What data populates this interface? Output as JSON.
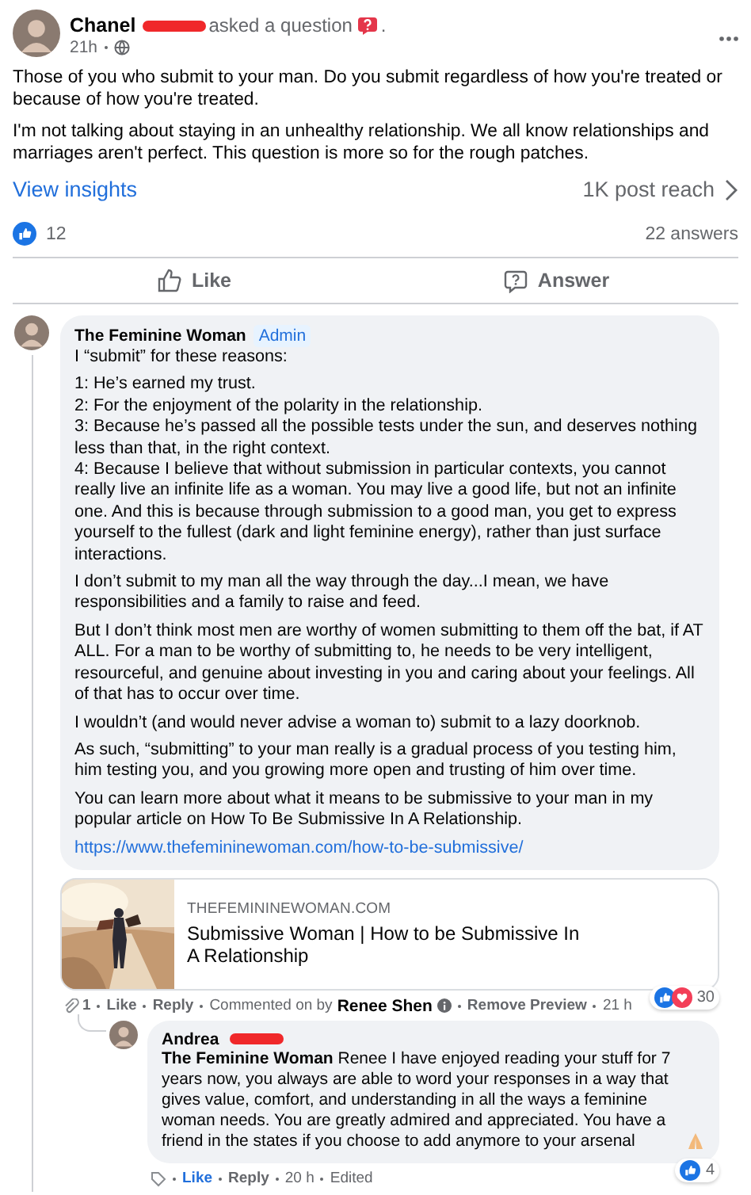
{
  "post": {
    "author": "Chanel",
    "action": "asked a question",
    "action_end": ".",
    "time": "21h",
    "paragraphs": [
      "Those of you who submit to your man. Do you submit regardless of how you're treated or because of how you're treated.",
      "I'm not talking about staying in an unhealthy relationship. We all know relationships and marriages aren't perfect. This question is more so for the rough patches."
    ],
    "insights_link": "View insights",
    "reach": "1K post reach",
    "reaction_count": "12",
    "answers": "22 answers",
    "actions": [
      {
        "kind": "like",
        "label": "Like"
      },
      {
        "kind": "answer",
        "label": "Answer"
      }
    ]
  },
  "comment": {
    "author": "The Feminine Woman",
    "badge": "Admin",
    "intro": "I “submit” for these reasons:",
    "list": [
      "1: He’s earned my trust.",
      "2: For the enjoyment of the polarity in the relationship.",
      "3: Because he’s passed all the possible tests under the sun, and deserves nothing less than that, in the right context.",
      "4: Because I believe that without submission in particular contexts, you cannot really live an infinite life as a woman. You may live a good life, but not an infinite one. And this is because through submission to a good man, you get to express yourself to the fullest (dark and light feminine energy), rather than just surface interactions."
    ],
    "paragraphs": [
      "I don’t submit to my man all the way through the day...I mean, we have responsibilities and a family to raise and feed.",
      "But I don’t think most men are worthy of women submitting to them off the bat, if AT ALL. For a man to be worthy of submitting to, he needs to be very intelligent, resourceful, and genuine about investing in you and caring about your feelings. All of that has to occur over time.",
      "I wouldn’t (and would never advise a woman to) submit to a lazy doorknob.",
      "As such, “submitting” to your man really is a gradual process of you testing him, him testing you, and you growing more open and trusting of him over time.",
      "You can learn more about what it means to be submissive to your man in my popular article on How To Be Submissive In A Relationship."
    ],
    "link": "https://www.thefemininewoman.com/how-to-be-submissive/",
    "preview": {
      "kind": "picture",
      "domain": "THEFEMININEWOMAN.COM",
      "title": "Submissive Woman | How to be Submissive In A Relationship"
    },
    "meta": {
      "attachments": "1",
      "like": "Like",
      "reply": "Reply",
      "commented_label": "Commented on by",
      "commented_by": "Renee Shen",
      "remove_preview": "Remove Preview",
      "time": "21 h"
    },
    "reactions": "30"
  },
  "reply": {
    "author": "Andrea",
    "text": "**The Feminine Woman** Renee I have enjoyed reading your stuff for 7 years now, you always are able to word your responses in a way that gives value, comfort, and understanding in all the ways a feminine woman needs. You are greatly admired and appreciated. You have a friend in the states if you choose to add anymore to your arsenal",
    "meta": {
      "like": "Like",
      "reply": "Reply",
      "time": "20 h",
      "edited": "Edited"
    },
    "reactions": "4"
  }
}
